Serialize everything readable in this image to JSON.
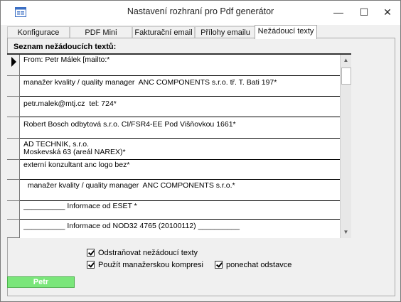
{
  "window": {
    "title": "Nastavení rozhraní pro Pdf generátor",
    "minimize_glyph": "—",
    "maximize_glyph": "☐",
    "close_glyph": "✕"
  },
  "tabs": [
    {
      "label": "Konfigurace",
      "active": false
    },
    {
      "label": "PDF Mini",
      "active": false
    },
    {
      "label": "Fakturační email",
      "active": false
    },
    {
      "label": "Přílohy emailu",
      "active": false
    },
    {
      "label": "Nežádoucí texty",
      "active": true
    }
  ],
  "list": {
    "label": "Seznam nežádoucích textů:",
    "rows": [
      {
        "lines": [
          "From: Petr Málek [mailto:*"
        ]
      },
      {
        "lines": [
          "manažer kvality / quality manager  ANC COMPONENTS s.r.o. tř. T. Bati 197*"
        ]
      },
      {
        "lines": [
          "petr.malek@mtj.cz  tel: 724*"
        ]
      },
      {
        "lines": [
          "Robert Bosch odbytová s.r.o. CI/FSR4-EE Pod Višňovkou 1661*"
        ]
      },
      {
        "lines": [
          "AD TECHNIK, s.r.o.",
          "Moskevská 63 (areál NAREX)*"
        ]
      },
      {
        "lines": [
          "externí konzultant anc logo bez*"
        ]
      },
      {
        "lines": [
          "  manažer kvality / quality manager  ANC COMPONENTS s.r.o.*"
        ]
      },
      {
        "lines": [
          "__________ Informace od ESET *"
        ]
      },
      {
        "lines": [
          "__________ Informace od NOD32 4765 (20100112) __________"
        ]
      }
    ]
  },
  "options": {
    "remove_unwanted": {
      "label": "Odstraňovat nežádoucí texty",
      "checked": true
    },
    "manager_compression": {
      "label": "Použít manažerskou kompresi",
      "checked": true
    },
    "keep_paragraphs": {
      "label": "ponechat odstavce",
      "checked": true
    }
  },
  "button": {
    "label": "Petr",
    "color": "#7ae67a"
  }
}
